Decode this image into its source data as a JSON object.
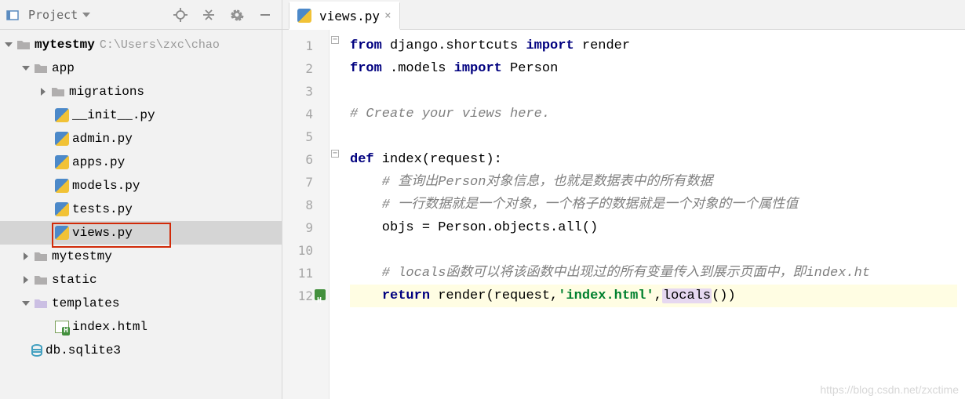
{
  "sidebar": {
    "title": "Project",
    "root": {
      "name": "mytestmy",
      "path": "C:\\Users\\zxc\\chao"
    },
    "app": "app",
    "migrations": "migrations",
    "files_app": [
      "__init__.py",
      "admin.py",
      "apps.py",
      "models.py",
      "tests.py",
      "views.py"
    ],
    "mytestmy2": "mytestmy",
    "static": "static",
    "templates": "templates",
    "index_html": "index.html",
    "db": "db.sqlite3"
  },
  "tabs": {
    "active": "views.py"
  },
  "code_lines": [
    "from django.shortcuts import render",
    "from .models import Person",
    "",
    "# Create your views here.",
    "",
    "def index(request):",
    "    # 查询出Person对象信息，也就是数据表中的所有数据",
    "    # 一行数据就是一个对象，一个格子的数据就是一个对象的一个属性值",
    "    objs = Person.objects.all()",
    "",
    "    # locals函数可以将该函数中出现过的所有变量传入到展示页面中，即index.ht",
    "    return render(request,'index.html',locals())"
  ],
  "line_numbers": [
    "1",
    "2",
    "3",
    "4",
    "5",
    "6",
    "7",
    "8",
    "9",
    "10",
    "11",
    "12"
  ],
  "watermark": "https://blog.csdn.net/zxctime"
}
